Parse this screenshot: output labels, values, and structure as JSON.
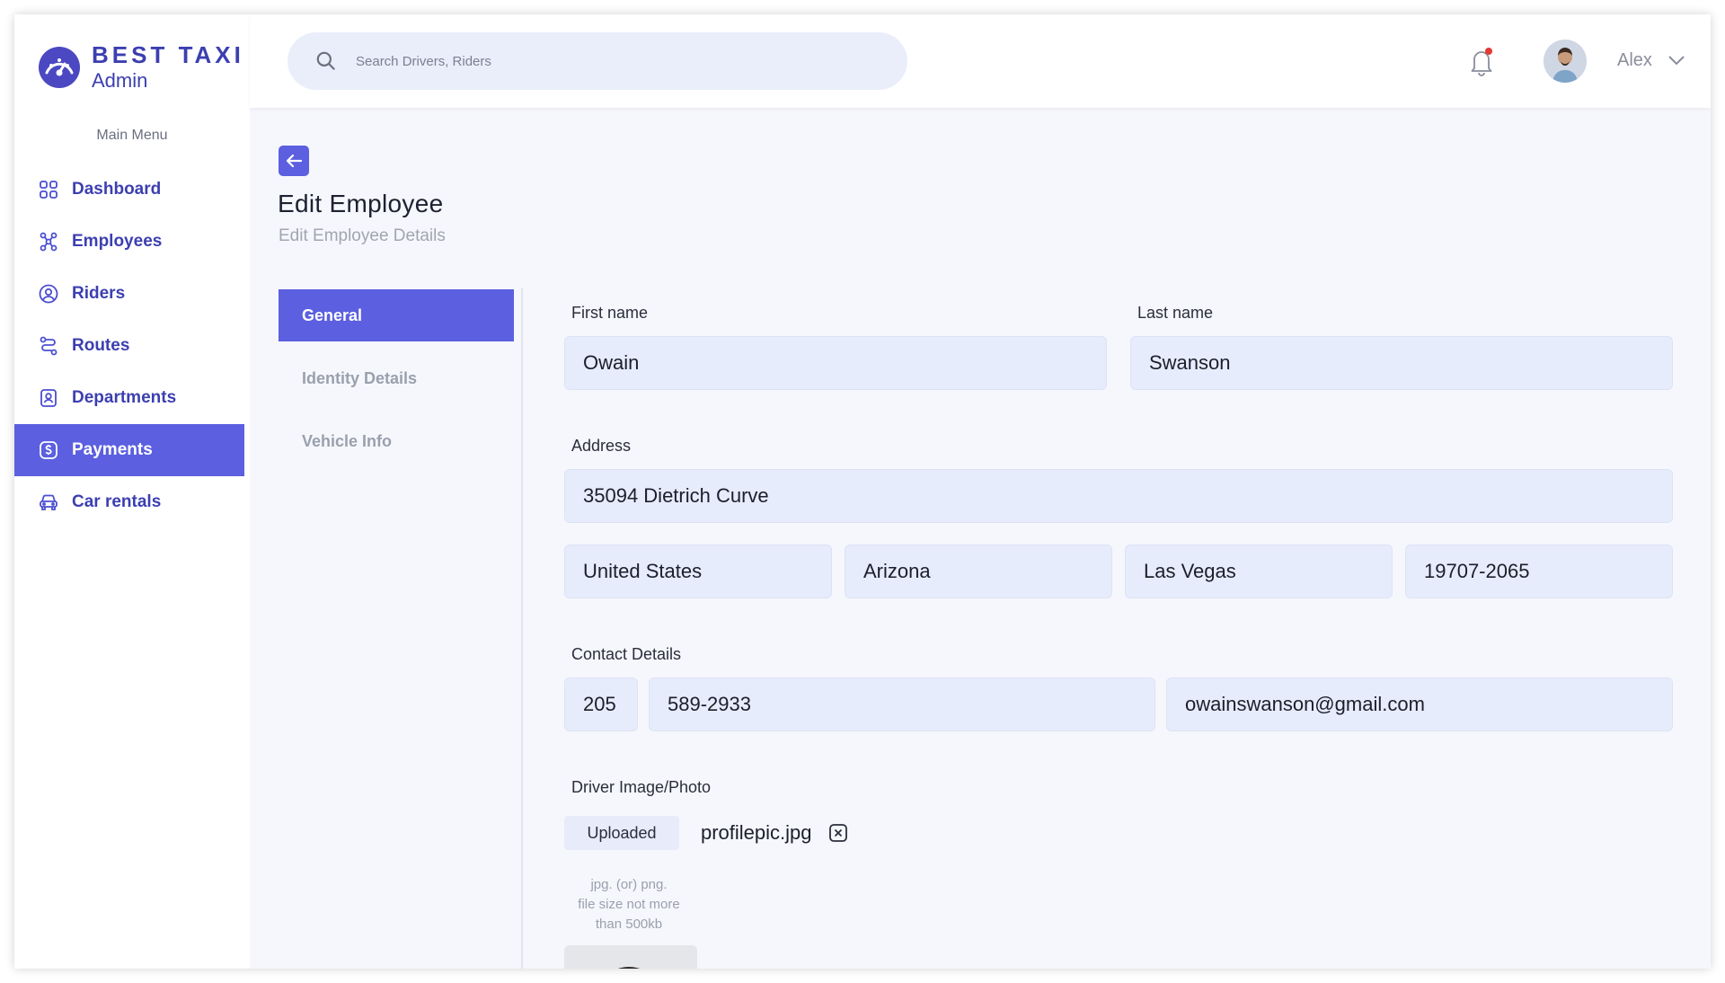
{
  "brand": {
    "name": "BEST TAXI",
    "sub": "Admin"
  },
  "sidebar": {
    "menu_title": "Main Menu",
    "items": [
      {
        "label": "Dashboard",
        "icon": "grid-icon"
      },
      {
        "label": "Employees",
        "icon": "users-network-icon"
      },
      {
        "label": "Riders",
        "icon": "user-circle-icon"
      },
      {
        "label": "Routes",
        "icon": "route-icon"
      },
      {
        "label": "Departments",
        "icon": "badge-icon"
      },
      {
        "label": "Payments",
        "icon": "dollar-icon",
        "active": true
      },
      {
        "label": "Car rentals",
        "icon": "car-icon"
      }
    ]
  },
  "header": {
    "search_placeholder": "Search Drivers, Riders",
    "user_name": "Alex"
  },
  "page": {
    "title": "Edit Employee",
    "subtitle": "Edit Employee Details"
  },
  "tabs": [
    {
      "label": "General",
      "active": true
    },
    {
      "label": "Identity Details"
    },
    {
      "label": "Vehicle Info"
    }
  ],
  "form": {
    "first_name_label": "First name",
    "first_name": "Owain",
    "last_name_label": "Last name",
    "last_name": "Swanson",
    "address_label": "Address",
    "address": "35094 Dietrich Curve",
    "country": "United States",
    "state": "Arizona",
    "city": "Las Vegas",
    "zip": "19707-2065",
    "contact_label": "Contact Details",
    "area_code": "205",
    "phone": "589-2933",
    "email": "owainswanson@gmail.com",
    "photo_label": "Driver Image/Photo",
    "upload_status": "Uploaded",
    "file_name": "profilepic.jpg",
    "hint_line1": "jpg. (or) png.",
    "hint_line2": "file size not more",
    "hint_line3": "than 500kb"
  },
  "colors": {
    "accent": "#5b5fe0",
    "brand": "#3c3fb0",
    "field_bg": "#e6ecfb",
    "notification_dot": "#e53935"
  }
}
